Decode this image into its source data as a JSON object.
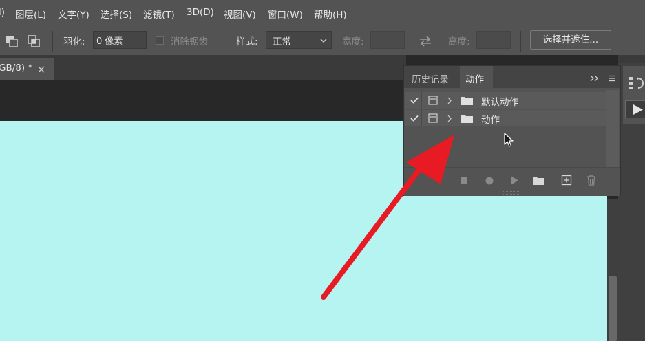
{
  "menu": {
    "items": [
      "l)",
      "图层(L)",
      "文字(Y)",
      "选择(S)",
      "滤镜(T)",
      "3D(D)",
      "视图(V)",
      "窗口(W)",
      "帮助(H)"
    ]
  },
  "options": {
    "feather_label": "羽化:",
    "feather_value": "0 像素",
    "antialias_label": "消除锯齿",
    "style_label": "样式:",
    "style_value": "正常",
    "width_label": "宽度:",
    "height_label": "高度:",
    "select_mask_button": "选择并遮住..."
  },
  "document": {
    "tab_label": "GB/8) *",
    "canvas_color": "#b5f4f1"
  },
  "actions_panel": {
    "tabs": [
      "历史记录",
      "动作"
    ],
    "active_tab": "动作",
    "rows": [
      {
        "checked": true,
        "label": "默认动作"
      },
      {
        "checked": true,
        "label": "动作"
      }
    ]
  },
  "annotation": {
    "arrow_color": "#e81b24"
  }
}
